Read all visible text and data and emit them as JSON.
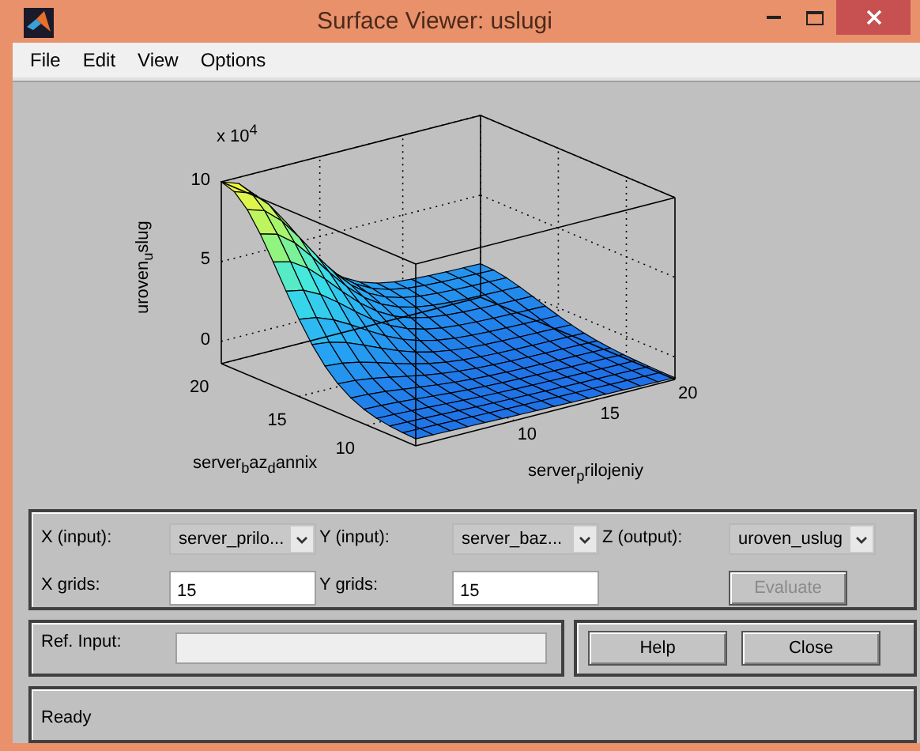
{
  "window": {
    "title": "Surface Viewer: uslugi"
  },
  "menu": [
    "File",
    "Edit",
    "View",
    "Options"
  ],
  "plot": {
    "exponent": "x 10$^{4}$",
    "zlabel": "uroven$_{u}$slug",
    "ylabel": "server$_{b}$az$_{d}$annix",
    "xlabel": "server$_{p}$rilojeniy",
    "zticks": [
      "10",
      "5",
      "0"
    ],
    "yticks": [
      "20",
      "15",
      "10"
    ],
    "xticks": [
      "10",
      "15",
      "20"
    ]
  },
  "selectors": [
    {
      "label": "X (input):",
      "value": "server_prilo..."
    },
    {
      "label": "Y (input):",
      "value": "server_baz..."
    },
    {
      "label": "Z (output):",
      "value": "uroven_uslug"
    }
  ],
  "grids": [
    {
      "label": "X grids:",
      "value": "15"
    },
    {
      "label": "Y grids:",
      "value": "15"
    }
  ],
  "evaluate": {
    "label": "Evaluate",
    "disabled": true
  },
  "ref_input": {
    "label": "Ref. Input:",
    "disabled": true
  },
  "buttons": [
    "Help",
    "Close"
  ],
  "status": "Ready"
}
